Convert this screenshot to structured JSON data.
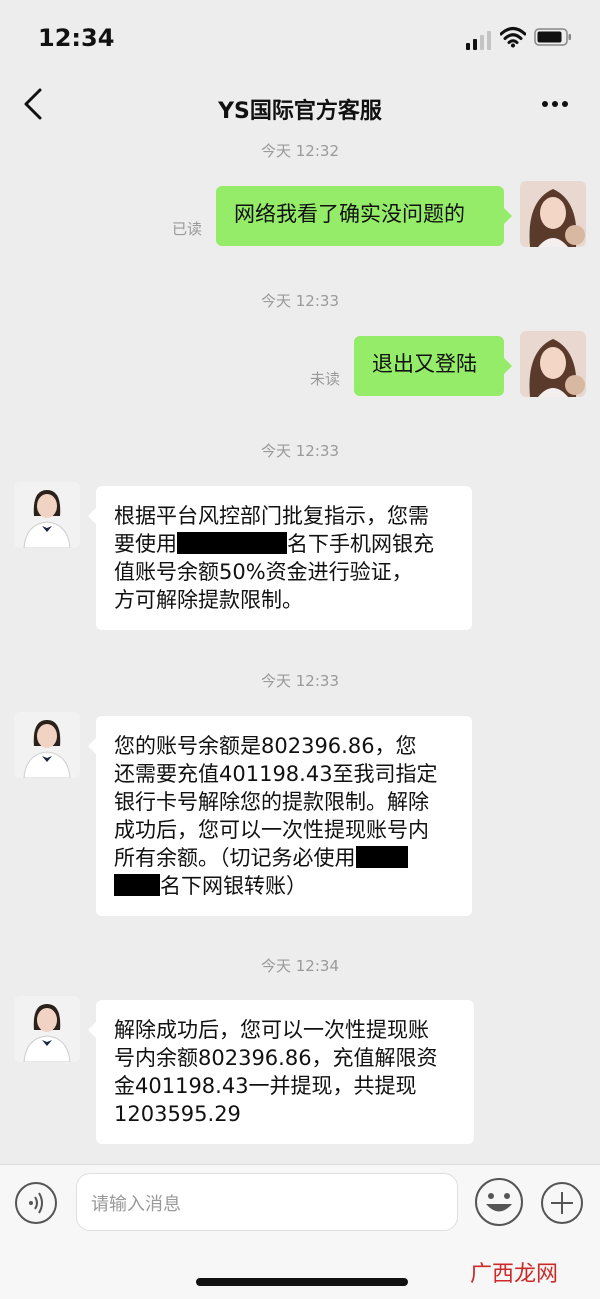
{
  "status": {
    "time": "12:34"
  },
  "nav": {
    "title": "YS国际官方客服"
  },
  "messages": {
    "ts1": "今天 12:32",
    "m1": "网络我看了确实没问题的",
    "m1_status": "已读",
    "ts2": "今天 12:33",
    "m2": "退出又登陆",
    "m2_status": "未读",
    "ts3": "今天 12:33",
    "m3": {
      "l1": "根据平台风控部门批复指示，您需",
      "l2a": "要使用",
      "l2b": "名下手机网银充",
      "l3": "值账号余额50%资金进行验证，",
      "l4": "方可解除提款限制。"
    },
    "ts4": "今天 12:33",
    "m4": {
      "l1": "您的账号余额是802396.86，您",
      "l2": "还需要充值401198.43至我司指定",
      "l3": "银行卡号解除您的提款限制。解除",
      "l4": "成功后，您可以一次性提现账号内",
      "l5a": "所有余额。（切记务必使用",
      "l6b": "名下网银转账）"
    },
    "ts5": "今天 12:34",
    "m5": {
      "l1": "解除成功后，您可以一次性提现账",
      "l2": "号内余额802396.86，充值解限资",
      "l3": "金401198.43一并提现，共提现",
      "l4": "1203595.29"
    }
  },
  "input": {
    "placeholder": "请输入消息"
  },
  "watermark": "广西龙网",
  "colors": {
    "my_bubble": "#95ec69",
    "their_bubble": "#ffffff",
    "background": "#ededed"
  }
}
